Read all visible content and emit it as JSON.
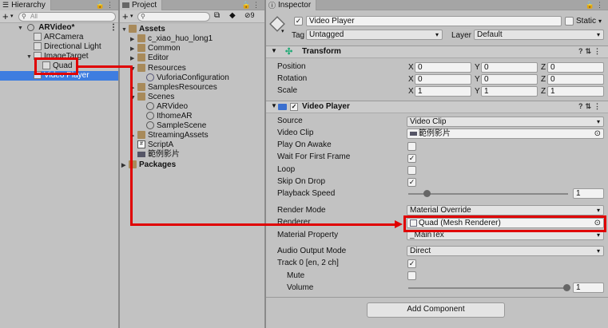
{
  "hierarchy": {
    "tab_label": "Hierarchy",
    "search_placeholder": "All",
    "scene_name": "ARVideo*",
    "items": [
      {
        "label": "ARCamera"
      },
      {
        "label": "Directional Light"
      },
      {
        "label": "ImageTarget"
      },
      {
        "label": "Quad"
      },
      {
        "label": "Video Player"
      }
    ]
  },
  "project": {
    "tab_label": "Project",
    "badge_count": "9",
    "items": [
      {
        "label": "Assets"
      },
      {
        "label": "c_xiao_huo_long1"
      },
      {
        "label": "Common"
      },
      {
        "label": "Editor"
      },
      {
        "label": "Resources"
      },
      {
        "label": "VuforiaConfiguration"
      },
      {
        "label": "SamplesResources"
      },
      {
        "label": "Scenes"
      },
      {
        "label": "ARVideo"
      },
      {
        "label": "IthomeAR"
      },
      {
        "label": "SampleScene"
      },
      {
        "label": "StreamingAssets"
      },
      {
        "label": "ScriptA"
      },
      {
        "label": "範例影片"
      },
      {
        "label": "Packages"
      }
    ]
  },
  "inspector": {
    "tab_label": "Inspector",
    "object_name": "Video Player",
    "static_label": "Static",
    "tag_label": "Tag",
    "tag_value": "Untagged",
    "layer_label": "Layer",
    "layer_value": "Default",
    "transform": {
      "title": "Transform",
      "rows": [
        {
          "label": "Position",
          "x": "0",
          "y": "0",
          "z": "0"
        },
        {
          "label": "Rotation",
          "x": "0",
          "y": "0",
          "z": "0"
        },
        {
          "label": "Scale",
          "x": "1",
          "y": "1",
          "z": "1"
        }
      ],
      "axis_x": "X",
      "axis_y": "Y",
      "axis_z": "Z"
    },
    "video_player": {
      "title": "Video Player",
      "source_label": "Source",
      "source_value": "Video Clip",
      "clip_label": "Video Clip",
      "clip_value": "範例影片",
      "play_on_awake_label": "Play On Awake",
      "play_on_awake": false,
      "wait_first_frame_label": "Wait For First Frame",
      "wait_first_frame": true,
      "loop_label": "Loop",
      "loop": false,
      "skip_on_drop_label": "Skip On Drop",
      "skip_on_drop": true,
      "playback_speed_label": "Playback Speed",
      "playback_speed_value": "1",
      "playback_speed_slider_fraction": 0.1,
      "render_mode_label": "Render Mode",
      "render_mode_value": "Material Override",
      "renderer_label": "Renderer",
      "renderer_value": "Quad (Mesh Renderer)",
      "material_property_label": "Material Property",
      "material_property_value": "_MainTex",
      "audio_output_label": "Audio Output Mode",
      "audio_output_value": "Direct",
      "track_label": "Track 0 [en, 2 ch]",
      "track_enabled": true,
      "mute_label": "Mute",
      "mute": false,
      "volume_label": "Volume",
      "volume_value": "1",
      "volume_slider_fraction": 1.0
    },
    "add_component_label": "Add Component"
  },
  "colors": {
    "highlight": "#e00000",
    "selection": "#3e7de0"
  }
}
